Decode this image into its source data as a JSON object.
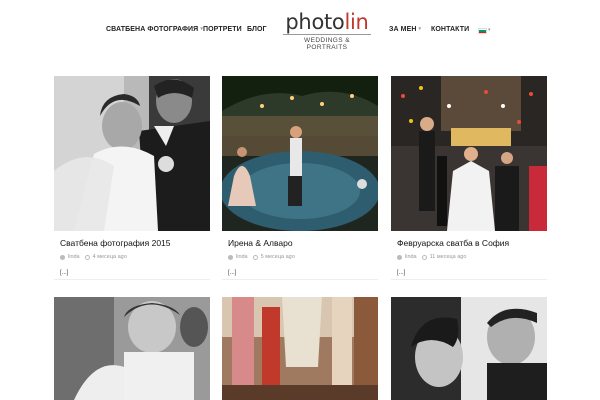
{
  "nav": {
    "wedding": "СВАТБЕНА ФОТОГРАФИЯ",
    "portraits": "ПОРТРЕТИ",
    "blog": "БЛОГ",
    "about": "ЗА МЕН",
    "contacts": "КОНТАКТИ",
    "flag_colors": [
      "#ffffff",
      "#00966e",
      "#d62612"
    ]
  },
  "logo": {
    "word_main": "photo",
    "word_accent": "lin",
    "subtitle": "WEDDINGS & PORTRAITS"
  },
  "posts": [
    {
      "title": "Сватбена фотография 2015",
      "author": "linda",
      "time": "4 месеца ago",
      "excerpt": "[...]"
    },
    {
      "title": "Ирена & Алваро",
      "author": "linda",
      "time": "5 месеца ago",
      "excerpt": "[...]"
    },
    {
      "title": "Февруарска сватба в София",
      "author": "linda",
      "time": "11 месеца ago",
      "excerpt": "[...]"
    }
  ],
  "colors": {
    "accent": "#c0392b"
  }
}
